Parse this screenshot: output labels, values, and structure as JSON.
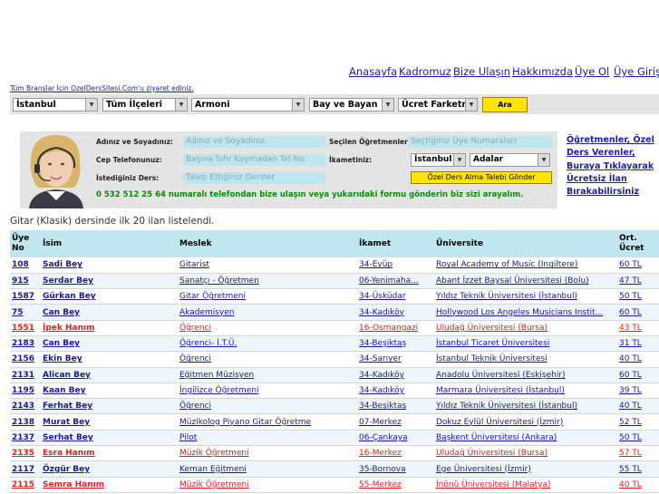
{
  "nav": {
    "links": [
      "Anasayfa",
      "Kadromuz",
      "Bize Ulaşın",
      "Hakkımızda",
      "Üye Ol",
      "Üye Girişi"
    ]
  },
  "all_branches_link": "Tüm Branşlar İçin OzelDersSitesi.Com'u ziyaret ediniz.",
  "filters": {
    "city": "İstanbul",
    "district": "Tüm İlçeleri",
    "subject": "Armoni",
    "gender": "Bay ve Bayan",
    "fee": "Ücret Farketmez",
    "search_button": "Ara"
  },
  "form": {
    "name_label": "Adınız ve Soyadınız:",
    "name_placeholder": "Adınız ve Soyadınız",
    "phone_label": "Cep Telefonunuz:",
    "phone_placeholder": "Başına Sıfır Koymadan Tel.No.",
    "lesson_label": "İstediğiniz Ders:",
    "lesson_placeholder": "Talep Ettiğiniz Dersler",
    "selected_teachers_label": "Seçilen Öğretmenler:",
    "selected_teachers_placeholder": "Seçtiğiniz Üye Numaraları",
    "residence_label": "İkametiniz:",
    "residence_city": "İstanbul",
    "residence_district": "Adalar",
    "submit_button": "Özel Ders Alma Talebi Gönder",
    "phone_notice": "0 532 512 25 64 numaralı telefondan bize ulaşın veya yukarıdaki formu gönderin biz sizi arayalım."
  },
  "side_link": "Öğretmenler, Özel Ders Verenler, Buraya Tıklayarak Ücretsiz İlan Bırakabilirsiniz",
  "listed_text": "Gitar (Klasik) dersinde ilk 20 ilan listelendi.",
  "table": {
    "headers": {
      "no": "Üye No",
      "name": "İsim",
      "job": "Meslek",
      "city": "İkamet",
      "uni": "Üniversite",
      "fee": "Ort. Ücret"
    },
    "rows": [
      {
        "no": "108",
        "name": "Sadi Bey",
        "job": "Gitarist",
        "city": "34-Eyüp",
        "uni": "Royal Academy of Music (Ingiltere)",
        "fee": "60 TL"
      },
      {
        "no": "915",
        "name": "Serdar Bey",
        "job": "Sanatçı - Öğretmen",
        "city": "06-Yenimaha...",
        "uni": "Abant İzzet Baysal Üniversitesi (Bolu)",
        "fee": "47 TL"
      },
      {
        "no": "1587",
        "name": "Gürkan Bey",
        "job": "Gitar Öğretmeni",
        "city": "34-Üsküdar",
        "uni": "Yıldız Teknik Üniversitesi (İstanbul)",
        "fee": "50 TL"
      },
      {
        "no": "75",
        "name": "Can Bey",
        "job": "Akademisyen",
        "city": "34-Kadıköy",
        "uni": "Hollywood Los Angeles Musicians Instit...",
        "fee": "60 TL"
      },
      {
        "no": "1551",
        "name": "İpek Hanım",
        "job": "Öğrenci",
        "city": "16-Osmangazi",
        "uni": "Uludağ Üniversitesi (Bursa)",
        "fee": "43 TL"
      },
      {
        "no": "2183",
        "name": "Can Bey",
        "job": "Öğrenci- İ.T.Ü.",
        "city": "34-Beşiktaş",
        "uni": "İstanbul Ticaret Üniversitesi",
        "fee": "31 TL"
      },
      {
        "no": "2156",
        "name": "Ekin Bey",
        "job": "Öğrenci",
        "city": "34-Sarıyer",
        "uni": "İstanbul Teknik Üniversitesi",
        "fee": "40 TL"
      },
      {
        "no": "2131",
        "name": "Alican Bey",
        "job": "Eğitmen Müzisyen",
        "city": "34-Kadıköy",
        "uni": "Anadolu Üniversitesi (Eskişehir)",
        "fee": "60 TL"
      },
      {
        "no": "1195",
        "name": "Kaan Bey",
        "job": "İngilizce Öğretmeni",
        "city": "34-Kadıköy",
        "uni": "Marmara Üniversitesi (İstanbul)",
        "fee": "39 TL"
      },
      {
        "no": "2143",
        "name": "Ferhat Bey",
        "job": "Öğrenci",
        "city": "34-Beşiktaş",
        "uni": "Yıldız Teknik Üniversitesi (İstanbul)",
        "fee": "40 TL"
      },
      {
        "no": "2138",
        "name": "Murat Bey",
        "job": "Müzikolog Piyano Gitar Öğretme",
        "city": "07-Merkez",
        "uni": "Dokuz Eylül Üniversitesi (İzmir)",
        "fee": "52 TL"
      },
      {
        "no": "2137",
        "name": "Serhat Bey",
        "job": "Pilot",
        "city": "06-Çankaya",
        "uni": "Başkent Üniversitesi (Ankara)",
        "fee": "50 TL"
      },
      {
        "no": "2135",
        "name": "Esra Hanım",
        "job": "Müzik Öğretmeni",
        "city": "16-Merkez",
        "uni": "Uludağ Üniversitesi (Bursa)",
        "fee": "57 TL"
      },
      {
        "no": "2117",
        "name": "Özgür Bey",
        "job": "Keman Eğitmeni",
        "city": "35-Bornova",
        "uni": "Ege Üniversitesi (İzmir)",
        "fee": "55 TL"
      },
      {
        "no": "2115",
        "name": "Semra Hanım",
        "job": "Müzik Öğretmeni",
        "city": "55-Merkez",
        "uni": "İnönü Üniversitesi (Malatya)",
        "fee": "40 TL"
      }
    ]
  },
  "colors": {
    "link": "#2020a0",
    "female_row": "#e02020",
    "header_bg": "#bfe5ee",
    "button_yellow": "#ffe400",
    "notice_green": "#0a8a0a"
  }
}
